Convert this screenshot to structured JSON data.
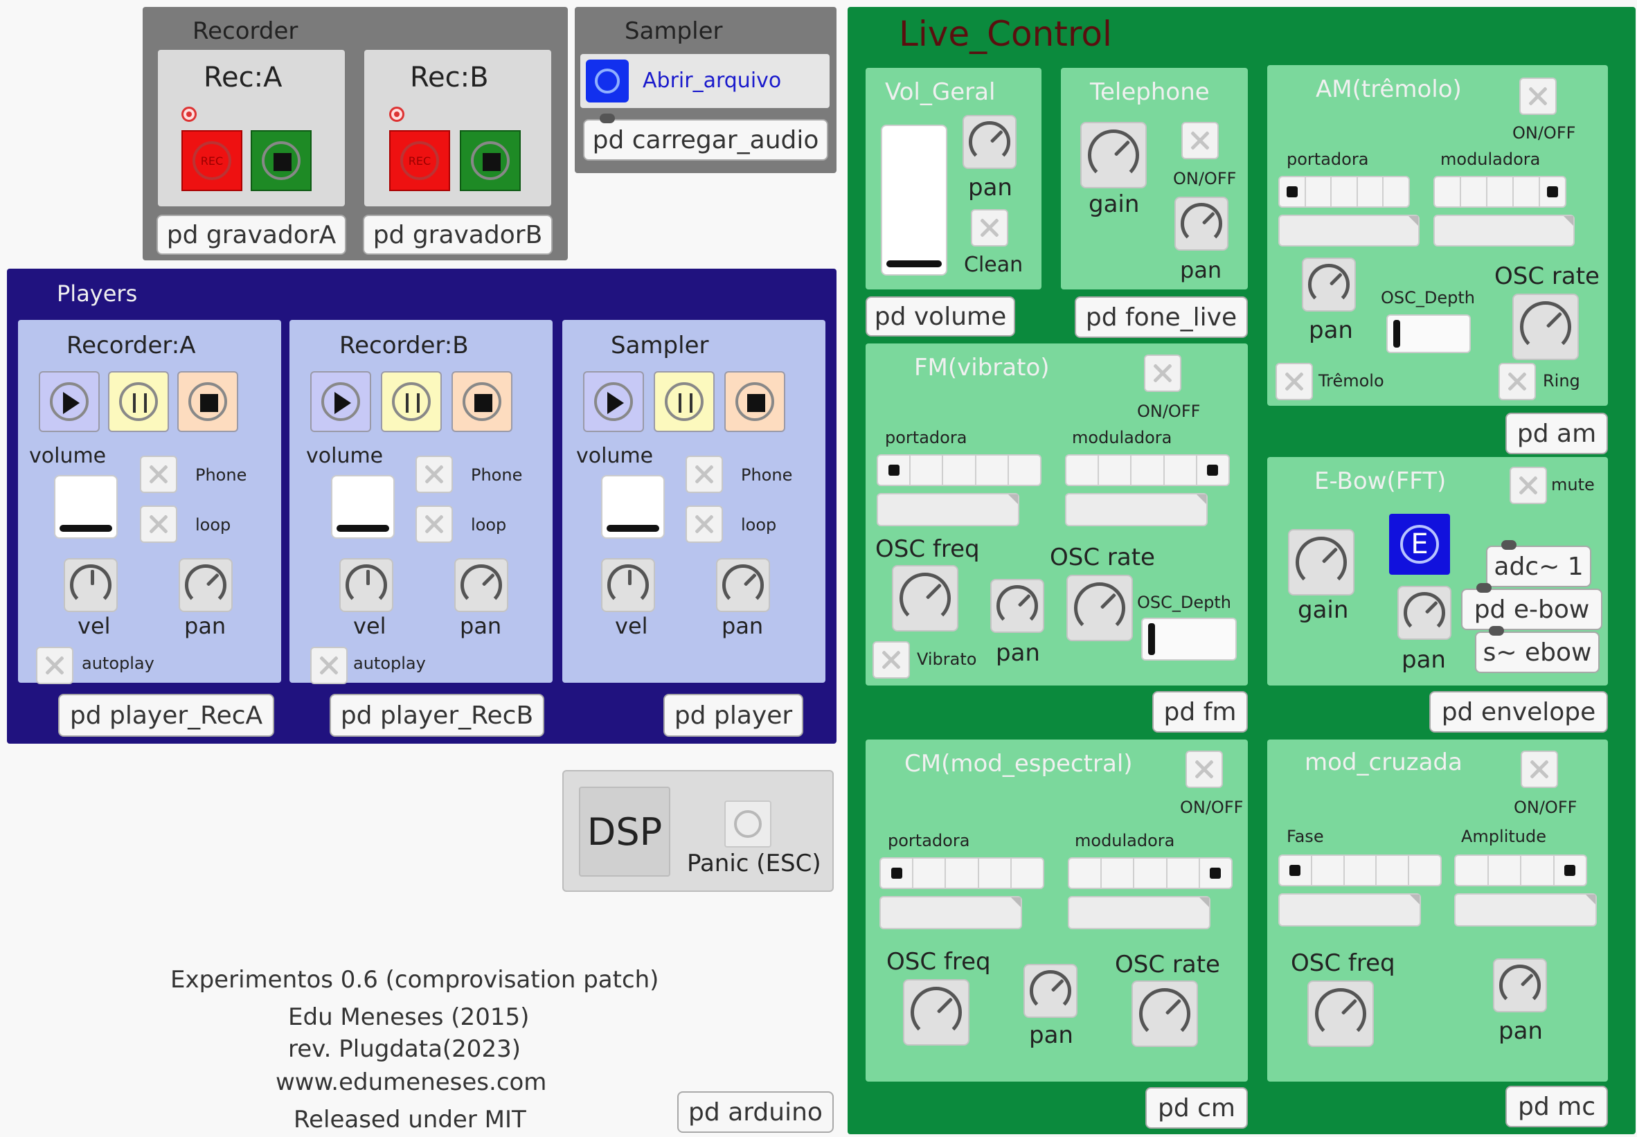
{
  "recorder": {
    "title": "Recorder",
    "recA": {
      "title": "Rec:A",
      "rec_label": "REC",
      "object": "pd gravadorA"
    },
    "recB": {
      "title": "Rec:B",
      "rec_label": "REC",
      "object": "pd gravadorB"
    }
  },
  "sampler": {
    "title": "Sampler",
    "open_label": "Abrir_arquivo",
    "object": "pd carregar_audio"
  },
  "players": {
    "title": "Players",
    "items": [
      {
        "title": "Recorder:A",
        "volume": "volume",
        "phone": "Phone",
        "loop": "loop",
        "vel": "vel",
        "pan": "pan",
        "autoplay": "autoplay",
        "object": "pd player_RecA"
      },
      {
        "title": "Recorder:B",
        "volume": "volume",
        "phone": "Phone",
        "loop": "loop",
        "vel": "vel",
        "pan": "pan",
        "autoplay": "autoplay",
        "object": "pd player_RecB"
      },
      {
        "title": "Sampler",
        "volume": "volume",
        "phone": "Phone",
        "loop": "loop",
        "vel": "vel",
        "pan": "pan",
        "object": "pd player"
      }
    ]
  },
  "dsp": {
    "label": "DSP",
    "panic": "Panic (ESC)"
  },
  "credits": {
    "line1": "Experimentos 0.6 (comprovisation patch)",
    "line2": "Edu Meneses (2015)",
    "line3": "rev. Plugdata(2023)",
    "line4": "www.edumeneses.com",
    "line5": "Released under MIT",
    "arduino": "pd arduino"
  },
  "live": {
    "title": "Live_Control",
    "vol": {
      "title": "Vol_Geral",
      "pan": "pan",
      "clean": "Clean",
      "object": "pd volume"
    },
    "tel": {
      "title": "Telephone",
      "gain": "gain",
      "onoff": "ON/OFF",
      "pan": "pan",
      "object": "pd fone_live"
    },
    "am": {
      "title": "AM(trêmolo)",
      "onoff": "ON/OFF",
      "portadora": "portadora",
      "moduladora": "moduladora",
      "pan": "pan",
      "depth": "OSC_Depth",
      "rate": "OSC rate",
      "tremolo": "Trêmolo",
      "ring": "Ring",
      "object": "pd am"
    },
    "fm": {
      "title": "FM(vibrato)",
      "onoff": "ON/OFF",
      "portadora": "portadora",
      "moduladora": "moduladora",
      "freq": "OSC freq",
      "rate": "OSC rate",
      "depth": "OSC_Depth",
      "vibrato": "Vibrato",
      "pan": "pan",
      "object": "pd fm"
    },
    "ebow": {
      "title": "E-Bow(FFT)",
      "mute": "mute",
      "e": "E",
      "gain": "gain",
      "pan": "pan",
      "adc": "adc~ 1",
      "pdebow": "pd e-bow",
      "sebow": "s~ ebow",
      "object": "pd envelope"
    },
    "cm": {
      "title": "CM(mod_espectral)",
      "onoff": "ON/OFF",
      "portadora": "portadora",
      "moduladora": "moduladora",
      "freq": "OSC freq",
      "pan": "pan",
      "rate": "OSC rate",
      "object": "pd cm"
    },
    "mc": {
      "title": "mod_cruzada",
      "onoff": "ON/OFF",
      "fase": "Fase",
      "amplitude": "Amplitude",
      "freq": "OSC freq",
      "pan": "pan",
      "object": "pd mc"
    }
  },
  "colors": {
    "navy": "#20127f",
    "dark_green": "#0b8a3d",
    "light_green": "#7bd89c",
    "player_blue": "#b8c4ee",
    "gray": "#7b7b7b"
  }
}
